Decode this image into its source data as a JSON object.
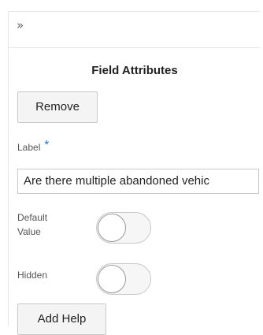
{
  "panel": {
    "collapse_glyph": "»",
    "title": "Field Attributes",
    "remove_label": "Remove",
    "label_field": {
      "label": "Label",
      "required_marker": "*",
      "value": "Are there multiple abandoned vehic"
    },
    "default_value": {
      "label_line1": "Default",
      "label_line2": "Value",
      "on": false
    },
    "hidden": {
      "label": "Hidden",
      "on": false
    },
    "add_help_label": "Add Help"
  },
  "colors": {
    "required_marker": "#1a73c8",
    "border": "#c8c8c8",
    "button_bg": "#f4f4f4"
  }
}
